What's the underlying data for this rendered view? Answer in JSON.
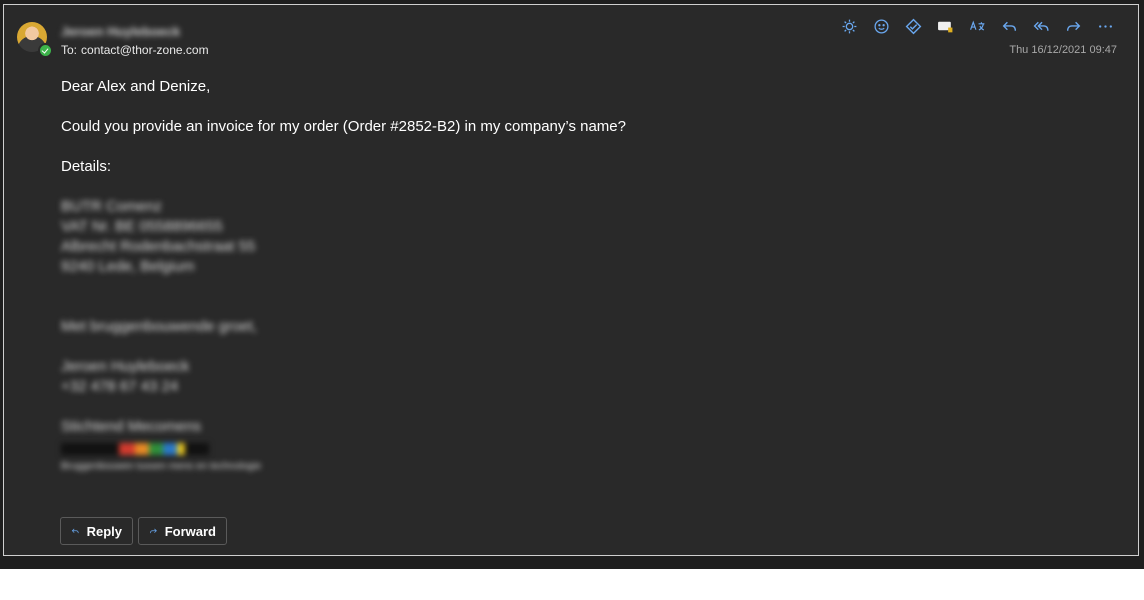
{
  "message": {
    "sender_name": "Jeroen Huyleboeck",
    "to_label": "To:",
    "to_address": "contact@thor-zone.com",
    "date": "Thu 16/12/2021 09:47"
  },
  "toolbar": {
    "icons": [
      "sun-icon",
      "emoji-icon",
      "sticker-icon",
      "reading-icon",
      "translate-icon",
      "reply-icon",
      "reply-all-icon",
      "forward-icon",
      "more-icon"
    ],
    "accent": "#6aa8f0"
  },
  "body": {
    "greeting": "Dear Alex and Denize,",
    "request": "Could you provide an invoice for my order (Order #2852-B2) in my company’s name?",
    "details_label": "Details:",
    "address": [
      "BUTR Comenz",
      "VAT Nr. BE 0558896655",
      "Albrecht Rodenbachstraat 55",
      "9240 Lede, Belgium"
    ],
    "closing": "Met bruggenbouwende groet,",
    "signature_name": "Jeroen Huyleboeck",
    "signature_phone": "+32 478 67 43 24",
    "organization": "Stichtend Mecomens",
    "tagline": "Bruggenbouwen tussen mens en technologie"
  },
  "actions": {
    "reply_label": "Reply",
    "forward_label": "Forward"
  }
}
